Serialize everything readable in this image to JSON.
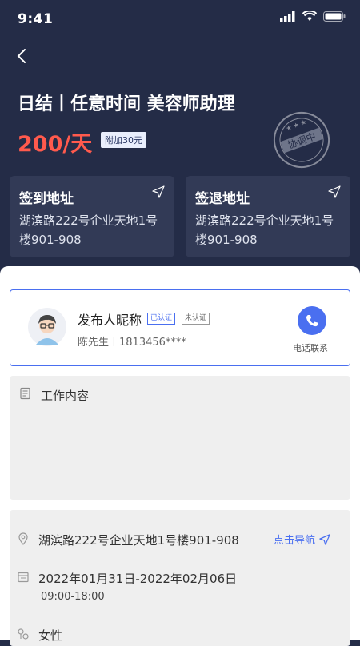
{
  "status": {
    "time": "9:41"
  },
  "job": {
    "title": "日结丨任意时间 美容师助理",
    "price": "200/天",
    "extra": "附加30元",
    "stamp": "协调中"
  },
  "checkin": {
    "label": "签到地址",
    "address": "湖滨路222号企业天地1号楼901-908"
  },
  "checkout": {
    "label": "签退地址",
    "address": "湖滨路222号企业天地1号楼901-908"
  },
  "publisher": {
    "name": "发布人昵称",
    "tag_verified": "已认证",
    "tag_unverified": "未认证",
    "contact": "陈先生丨1813456****",
    "call_label": "电话联系"
  },
  "work": {
    "title": "工作内容"
  },
  "info": {
    "address": "湖滨路222号企业天地1号楼901-908",
    "nav_label": "点击导航",
    "date_range": "2022年01月31日-2022年02月06日",
    "time_range": "09:00-18:00",
    "gender": "女性"
  },
  "colors": {
    "header": "#242c47",
    "accent": "#4a6ff0",
    "price": "#ff5a4d"
  }
}
